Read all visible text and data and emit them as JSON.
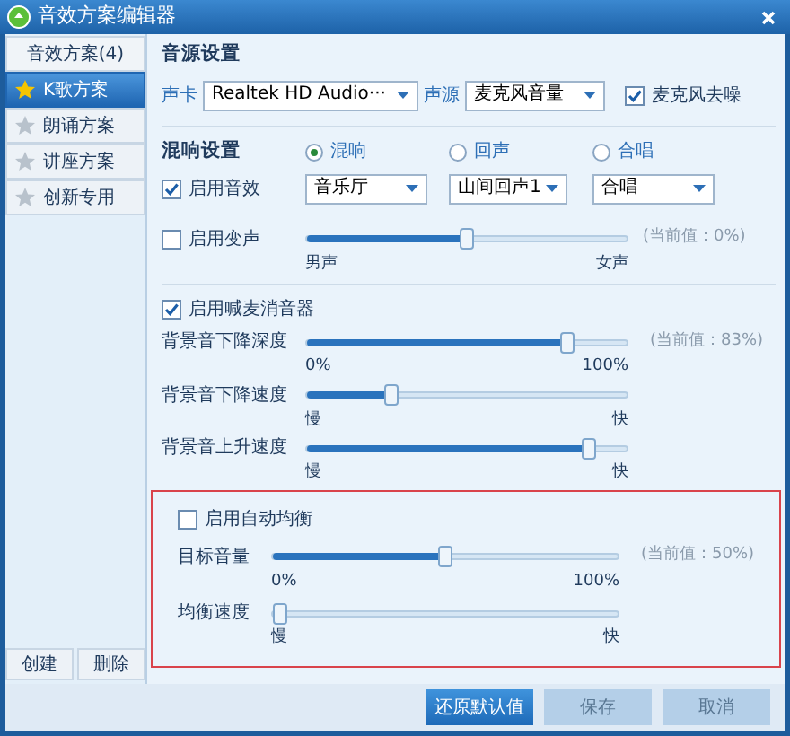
{
  "window": {
    "title": "音效方案编辑器"
  },
  "sidebar": {
    "header": "音效方案(4)",
    "items": [
      {
        "label": "K歌方案",
        "selected": true
      },
      {
        "label": "朗诵方案",
        "selected": false
      },
      {
        "label": "讲座方案",
        "selected": false
      },
      {
        "label": "创新专用",
        "selected": false
      }
    ],
    "buttons": [
      "创建",
      "删除"
    ]
  },
  "source": {
    "title": "音源设置",
    "card_label": "声卡",
    "card_value": "Realtek HD Audio···",
    "source_label": "声源",
    "source_value": "麦克风音量",
    "denoise": {
      "label": "麦克风去噪",
      "checked": true
    }
  },
  "reverb": {
    "title": "混响设置",
    "modes": [
      {
        "label": "混响",
        "selected": true
      },
      {
        "label": "回声",
        "selected": false
      },
      {
        "label": "合唱",
        "selected": false
      }
    ],
    "effect": {
      "label": "启用音效",
      "checked": true
    },
    "dropdowns": [
      "音乐厅",
      "山间回声1",
      "合唱"
    ],
    "voice": {
      "label": "启用变声",
      "checked": false,
      "level": 0.5,
      "reading": "(当前值：0%)",
      "min": "男声",
      "max": "女声"
    }
  },
  "ducker": {
    "label": "启用喊麦消音器",
    "checked": true,
    "sliders": [
      {
        "label": "背景音下降深度",
        "level": 0.83,
        "reading": "(当前值：83%)",
        "min": "0%",
        "max": "100%"
      },
      {
        "label": "背景音下降速度",
        "level": 0.25,
        "min": "慢",
        "max": "快"
      },
      {
        "label": "背景音上升速度",
        "level": 0.9,
        "min": "慢",
        "max": "快"
      }
    ]
  },
  "balance": {
    "label": "启用自动均衡",
    "checked": false,
    "sliders": [
      {
        "label": "目标音量",
        "level": 0.5,
        "reading": "(当前值：50%)",
        "min": "0%",
        "max": "100%"
      },
      {
        "label": "均衡速度",
        "level": 0,
        "min": "慢",
        "max": "快"
      }
    ]
  },
  "buttons": [
    {
      "label": "还原默认值",
      "disabled": false
    },
    {
      "label": "保存",
      "disabled": true
    },
    {
      "label": "取消",
      "disabled": true
    }
  ]
}
